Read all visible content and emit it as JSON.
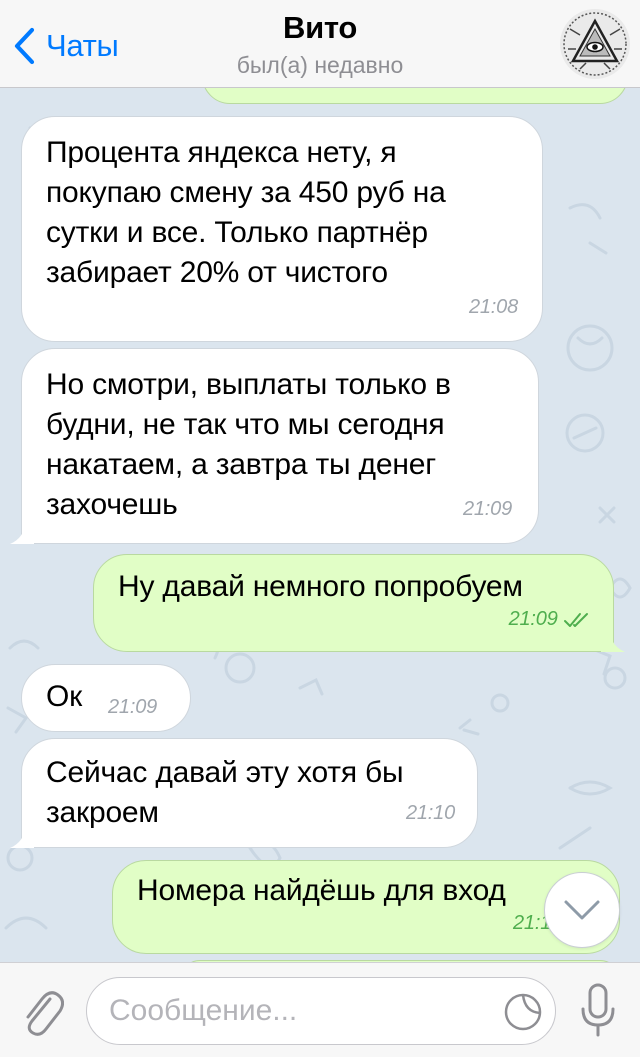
{
  "header": {
    "back_label": "Чаты",
    "title": "Вито",
    "status": "был(а) недавно"
  },
  "messages": [
    {
      "direction": "incoming",
      "lines": [
        "Процента яндекса нету, я",
        "покупаю смену за 450 руб на",
        "сутки и все. Только партнёр",
        "забирает 20% от чистого"
      ],
      "time": "21:08"
    },
    {
      "direction": "incoming",
      "lines": [
        "Но смотри, выплаты только в",
        "будни, не так что мы сегодня",
        "накатаем, а завтра ты денег",
        "захочешь"
      ],
      "time": "21:09"
    },
    {
      "direction": "outgoing",
      "lines": [
        "Ну давай немного попробуем"
      ],
      "time": "21:09",
      "read": true
    },
    {
      "direction": "incoming",
      "lines": [
        "Ок"
      ],
      "time": "21:09"
    },
    {
      "direction": "incoming",
      "lines": [
        "Сейчас давай эту хотя бы",
        "закроем"
      ],
      "time": "21:10"
    },
    {
      "direction": "outgoing",
      "lines": [
        "Номера найдёшь для вход"
      ],
      "time": "21:1"
    }
  ],
  "input": {
    "placeholder": "Сообщение..."
  },
  "icons": {
    "back": "chevron-left-icon",
    "attach": "paperclip-icon",
    "sticker": "sticker-icon",
    "mic": "microphone-icon",
    "scroll": "chevron-down-icon"
  },
  "colors": {
    "accent": "#007aff",
    "incoming_bubble": "#ffffff",
    "outgoing_bubble": "#e1fec6",
    "outgoing_time": "#4fae4e",
    "wallpaper": "#dbe5ee"
  }
}
